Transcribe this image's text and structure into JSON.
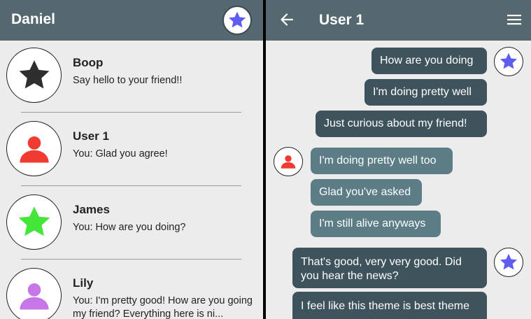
{
  "colors": {
    "appbar": "#556870",
    "background": "#ececec",
    "bubble_me": "#3f535c",
    "bubble_other": "#5c7c86",
    "star_blue": "#5f5cf0",
    "user_red": "#ef3b32",
    "star_green": "#45e63a",
    "user_purple": "#c676e6",
    "star_dark": "#2e2e2e"
  },
  "left_pane": {
    "title": "Daniel",
    "profile_icon": "blue-star-icon",
    "contacts": [
      {
        "name": "Boop",
        "preview": "Say hello to your friend!!",
        "icon": "dark-star-icon"
      },
      {
        "name": "User 1",
        "preview": "You: Glad you agree!",
        "icon": "red-person-icon"
      },
      {
        "name": "James",
        "preview": "You: How are you doing?",
        "icon": "green-star-icon"
      },
      {
        "name": "Lily",
        "preview": "You: I'm pretty good! How are you going my friend? Everything here is ni...",
        "icon": "purple-person-icon"
      }
    ]
  },
  "chat": {
    "title": "User 1",
    "back_icon": "arrow-left-icon",
    "menu_icon": "hamburger-menu-icon",
    "messages": [
      {
        "sender": "me",
        "text": "How are you doing"
      },
      {
        "sender": "me",
        "text": "I'm doing pretty well"
      },
      {
        "sender": "me",
        "text": "Just curious about my friend!"
      },
      {
        "sender": "other",
        "text": "I'm doing pretty well too"
      },
      {
        "sender": "other",
        "text": "Glad you've asked"
      },
      {
        "sender": "other",
        "text": "I'm still alive anyways"
      },
      {
        "sender": "me",
        "text": "That's good, very very good. Did you hear the news?"
      },
      {
        "sender": "me",
        "text": "I feel like this theme is best theme"
      }
    ]
  }
}
